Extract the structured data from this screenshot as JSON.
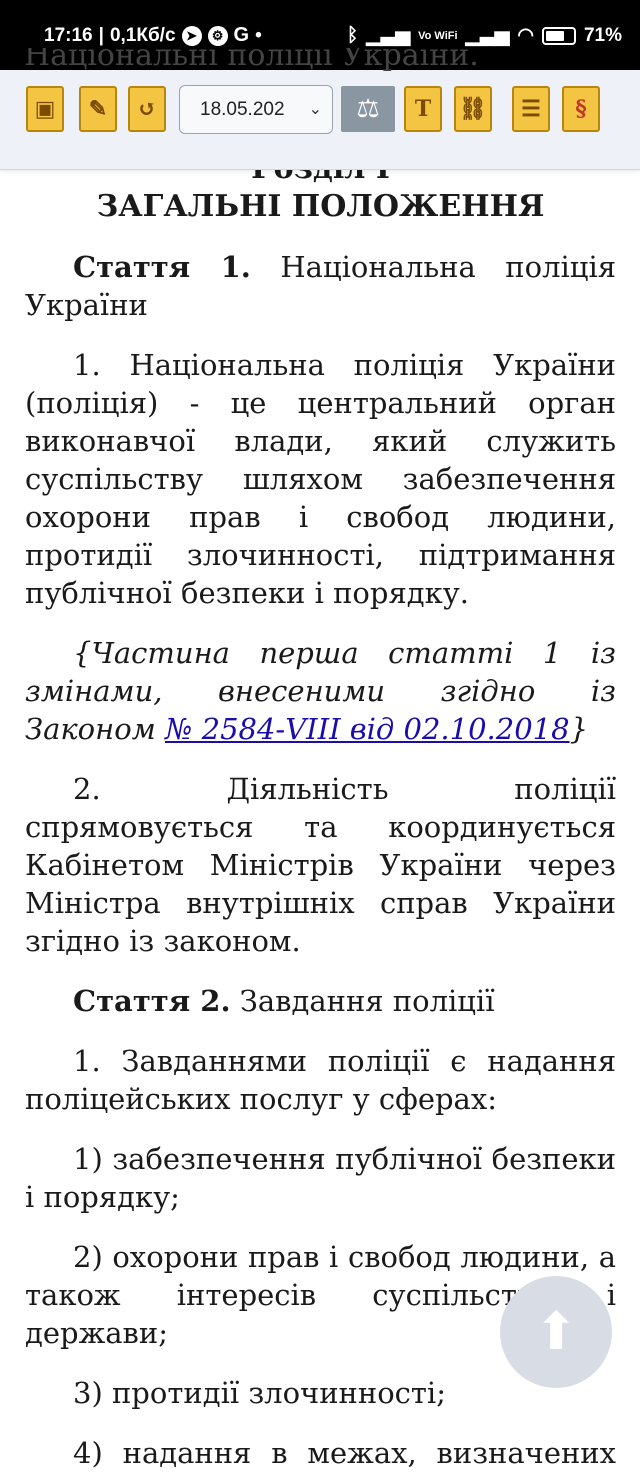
{
  "status_bar": {
    "time": "17:16",
    "net_speed": "0,1Кб/с",
    "app_icons": [
      "telegram-icon",
      "steam-icon"
    ],
    "g_letter": "G",
    "dots": "•",
    "wifi_label": "Vo WiFi",
    "battery": "71%",
    "battery_level": 0.71
  },
  "toolbar": {
    "ghost_text": "Національні поліції України.",
    "date_value": "18.05.202",
    "buttons": [
      {
        "icon": "archive-icon",
        "glyph": "▣"
      },
      {
        "icon": "edit-icon",
        "glyph": "✎"
      },
      {
        "icon": "history-icon",
        "glyph": "↺"
      },
      {
        "icon": "scales-icon",
        "glyph": "⚖"
      },
      {
        "icon": "text-icon",
        "glyph": "T"
      },
      {
        "icon": "link-icon",
        "glyph": "⛓"
      },
      {
        "icon": "structure-icon",
        "glyph": "☰"
      },
      {
        "icon": "paragraph-icon",
        "glyph": "§"
      }
    ]
  },
  "doc": {
    "section_title": "Розділ I",
    "section_name": "ЗАГАЛЬНІ ПОЛОЖЕННЯ",
    "art1_label": "Стаття 1.",
    "art1_title": "Національна поліція України",
    "art1_p1": "1. Національна поліція України (поліція) - це центральний орган виконавчої влади, який служить суспільству шляхом забезпечення охорони прав і свобод людини, протидії злочинності, підтримання публічної безпеки і порядку.",
    "art1_note_prefix": "{Частина перша статті 1 із змінами, внесеними згідно із Законом",
    "art1_note_link": "№ 2584-VIII від 02.10.2018",
    "art1_note_suffix": "}",
    "art1_p2": "2. Діяльність поліції спрямовується та координується Кабінетом Міністрів України через Міністра внутрішніх справ України згідно із законом.",
    "art2_label": "Стаття 2.",
    "art2_title": "Завдання поліції",
    "art2_p1": "1. Завданнями поліції є надання поліцейських послуг у сферах:",
    "art2_i1": "1) забезпечення публічної безпеки і порядку;",
    "art2_i2": "2) охорони прав і свобод людини, а також інтересів суспільства і держави;",
    "art2_i3": "3) протидії злочинності;",
    "art2_i4": "4) надання в межах, визначених"
  },
  "fab": {
    "icon": "arrow-up-icon",
    "glyph": "⬆"
  }
}
